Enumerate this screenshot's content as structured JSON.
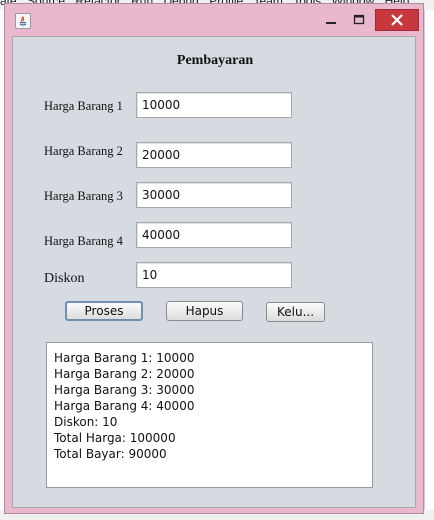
{
  "background_ide": {
    "menu_items": [
      "ate",
      "Source",
      "Refactor",
      "Run",
      "Debug",
      "Profile",
      "Team",
      "Tools",
      "Window",
      "Help"
    ]
  },
  "window": {
    "close_icon": "close-icon",
    "minimize_icon": "minimize-icon",
    "maximize_icon": "maximize-icon",
    "close_color": "#c7383e",
    "frame_color": "#e9b8cf"
  },
  "form": {
    "title": "Pembayaran",
    "fields": [
      {
        "label": "Harga Barang 1",
        "value": "10000"
      },
      {
        "label": "Harga Barang 2",
        "value": "20000"
      },
      {
        "label": "Harga Barang 3",
        "value": "30000"
      },
      {
        "label": "Harga Barang 4",
        "value": "40000"
      },
      {
        "label": "Diskon",
        "value": "10"
      }
    ],
    "buttons": {
      "proses": "Proses",
      "hapus": "Hapus",
      "keluar": "Kelu..."
    },
    "output_lines": [
      "Harga Barang 1: 10000",
      "Harga Barang 2: 20000",
      "Harga Barang 3: 30000",
      "Harga Barang 4: 40000",
      "Diskon: 10",
      "Total Harga: 100000",
      "Total Bayar: 90000"
    ]
  }
}
